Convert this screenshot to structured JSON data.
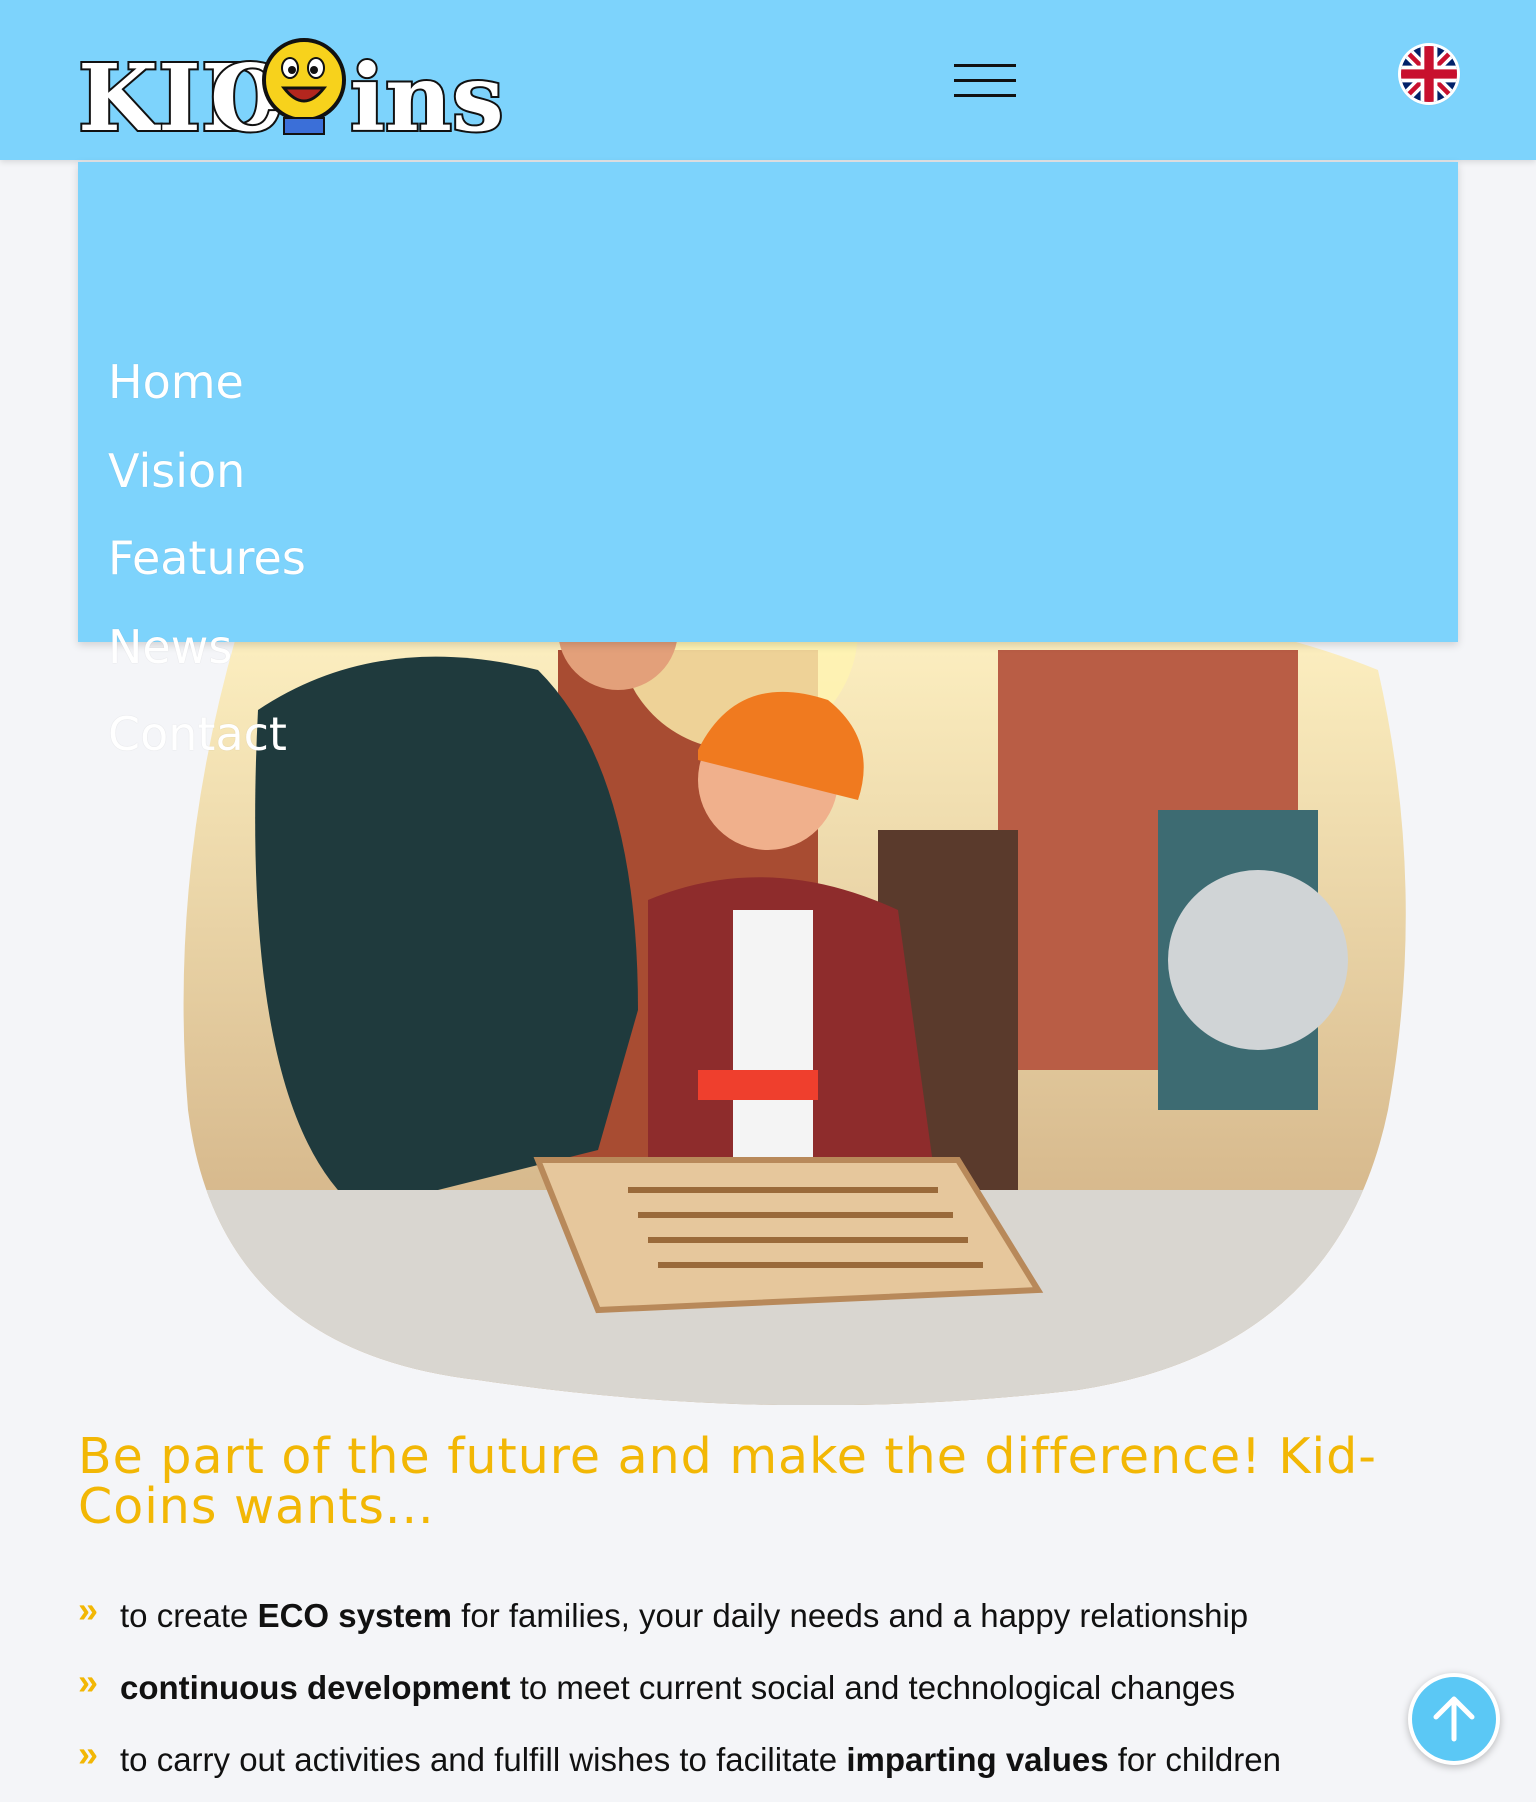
{
  "header": {
    "logo_text_left": "KID",
    "logo_text_right": "ins",
    "logo_letter_c": "C",
    "menu_icon": "hamburger-menu-icon",
    "language_icon": "uk-flag-icon"
  },
  "menu": {
    "items": [
      {
        "label": "Home"
      },
      {
        "label": "Vision"
      },
      {
        "label": "Features"
      },
      {
        "label": "News"
      },
      {
        "label": "Contact"
      }
    ]
  },
  "hero": {
    "image": "father-and-son-woodworking-photo"
  },
  "main": {
    "headline": "Be part of the future and make the difference! Kid-Coins wants...",
    "bullet_marker": "»",
    "bullets": [
      {
        "pre": "to create ",
        "bold": "ECO system",
        "post": " for families, your daily needs and a happy relationship"
      },
      {
        "pre": "",
        "bold": "continuous development",
        "post": " to meet current social and technological changes"
      },
      {
        "pre": "to carry out activities and fulfill wishes to facilitate ",
        "bold": "imparting values",
        "post": " for children"
      }
    ]
  },
  "scroll_top": {
    "icon": "arrow-up-icon"
  },
  "colors": {
    "header_bg": "#7dd3fc",
    "accent_yellow": "#f2b705",
    "page_bg": "#f4f5f8",
    "button_blue": "#5bc8f5"
  }
}
